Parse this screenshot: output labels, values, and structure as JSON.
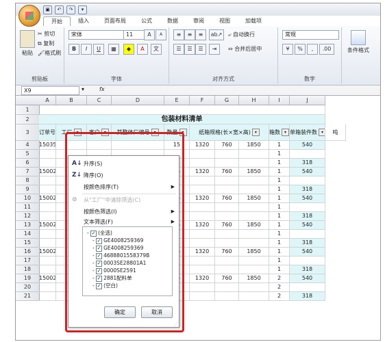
{
  "quick_access": [
    "▣",
    "↶",
    "↷",
    "▾"
  ],
  "ribbon_tabs": [
    "开始",
    "插入",
    "页面布局",
    "公式",
    "数据",
    "审阅",
    "视图",
    "加载项"
  ],
  "ribbon": {
    "clipboard": {
      "paste": "粘贴",
      "cut": "剪切",
      "copy": "复制",
      "format_painter": "格式刷",
      "label": "剪贴板"
    },
    "font": {
      "font_name": "宋体",
      "font_size": "11",
      "bold": "B",
      "italic": "I",
      "underline": "U",
      "label": "字体",
      "grow": "A",
      "shrink": "A"
    },
    "alignment": {
      "wrap": "自动换行",
      "merge": "合并后居中",
      "label": "对齐方式"
    },
    "number": {
      "format": "常规",
      "percent": "%",
      "label": "数字"
    },
    "styles": {
      "cond": "条件格式",
      "label": "样式"
    }
  },
  "formula_bar": {
    "name_box": "X9",
    "fx": "fx",
    "value": ""
  },
  "columns": [
    "A",
    "B",
    "C",
    "D",
    "E",
    "F",
    "G",
    "H",
    "I",
    "J"
  ],
  "rows": [
    "1",
    "2",
    "3",
    "4",
    "5",
    "6",
    "7",
    "8",
    "9",
    "10",
    "11",
    "12",
    "13",
    "14",
    "15",
    "16",
    "17",
    "18",
    "19",
    "20",
    "21"
  ],
  "sheet": {
    "title": "包装材料清单",
    "headers": {
      "order": "订单号",
      "process": "工厂",
      "customer": "客户",
      "part": "其整体厂编号",
      "qty": "数量",
      "spec": "纸箱规格(长×宽×高)",
      "unit": "箱数",
      "price": "单箱装件数",
      "extra": "吨"
    },
    "data_rows": [
      {
        "row": "4",
        "order": "150352",
        "e": "15",
        "f": "1320",
        "g": "760",
        "h": "1850",
        "i": "1",
        "j": "540"
      },
      {
        "row": "5",
        "i": "1"
      },
      {
        "row": "6",
        "i": "1",
        "j": "318"
      },
      {
        "row": "7",
        "order": "150023",
        "e": "15",
        "f": "1320",
        "g": "760",
        "h": "1850",
        "i": "1",
        "j": "540"
      },
      {
        "row": "8",
        "i": "1"
      },
      {
        "row": "9",
        "i": "1",
        "j": "318"
      },
      {
        "row": "10",
        "order": "150023",
        "e": "15",
        "f": "1320",
        "g": "760",
        "h": "1850",
        "i": "1",
        "j": "540"
      },
      {
        "row": "11",
        "i": "1"
      },
      {
        "row": "12",
        "i": "1",
        "j": "318"
      },
      {
        "row": "13",
        "order": "150023",
        "e": "15",
        "f": "1320",
        "g": "760",
        "h": "1850",
        "i": "1",
        "j": "540"
      },
      {
        "row": "14",
        "i": "1"
      },
      {
        "row": "15",
        "i": "1",
        "j": "318"
      },
      {
        "row": "16",
        "order": "150023",
        "e": "15",
        "f": "1320",
        "g": "760",
        "h": "1850",
        "i": "1",
        "j": "540"
      },
      {
        "row": "17",
        "i": "1"
      },
      {
        "row": "18",
        "i": "1",
        "j": "318"
      },
      {
        "row": "19",
        "order": "150023",
        "e": "15",
        "f": "1320",
        "g": "760",
        "h": "1850",
        "i": "2",
        "j": "540"
      },
      {
        "row": "20",
        "i": "2"
      },
      {
        "row": "21",
        "i": "2",
        "j": "318"
      }
    ]
  },
  "dropdown": {
    "sort_asc": "升序(S)",
    "sort_desc": "降序(O)",
    "sort_color": "按颜色排序(T)",
    "clear_filter": "从\"工厂\"中清除筛选(C)",
    "filter_color": "按颜色筛选(I)",
    "text_filter": "文本筛选(F)",
    "items": [
      {
        "label": "(全选)",
        "checked": true
      },
      {
        "label": "GE4008259369",
        "checked": true
      },
      {
        "label": "GE4008259369",
        "checked": true
      },
      {
        "label": "4688801558379B",
        "checked": true
      },
      {
        "label": "0003SE28801A1",
        "checked": true
      },
      {
        "label": "0000SE2591",
        "checked": true
      },
      {
        "label": "2881配料单",
        "checked": true
      },
      {
        "label": "(空白)",
        "checked": true
      }
    ],
    "ok": "确定",
    "cancel": "取消"
  }
}
